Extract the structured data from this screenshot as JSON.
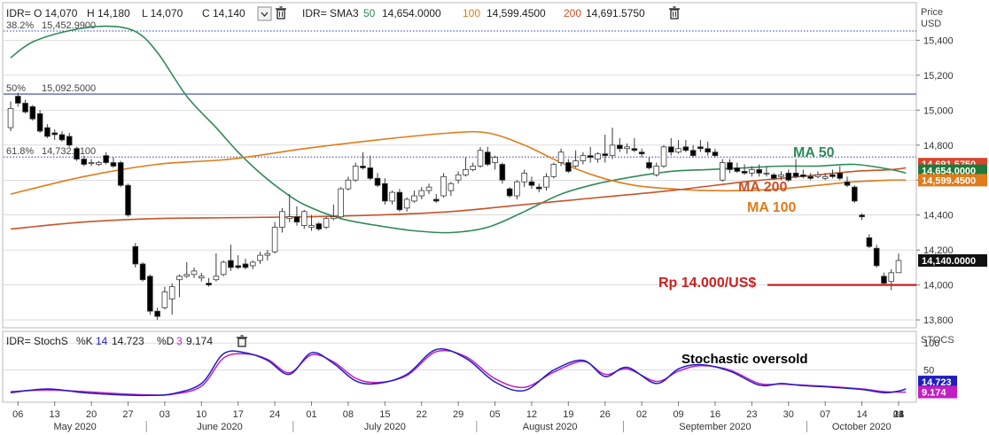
{
  "colors": {
    "up": "#ffffff",
    "down": "#000000",
    "candle_edge": "#3a3a3a",
    "ma50": "#2e8b57",
    "ma100": "#e07b1a",
    "ma200": "#c8532a",
    "support_line": "#cc1f1f",
    "fib_dotted": "#2b3fa8",
    "fib_solid": "#4b56b5",
    "stoch_k": "#1f1fbf",
    "stoch_d": "#c21ec2",
    "grid": "#c8c8c8",
    "box_green": "#1e7a3a",
    "box_orange": "#e07b1a",
    "box_red": "#d8452b",
    "box_blue": "#1f1fbf",
    "box_magenta": "#c21ec2",
    "box_black": "#111111"
  },
  "header": {
    "ohlc": [
      "IDR= O 14,070",
      "H 14,180",
      "L 14,070",
      "C 14,140"
    ],
    "sma_prefix": "IDR= SMA3",
    "sma": [
      {
        "len": "50",
        "value": "14,654.0000"
      },
      {
        "len": "100",
        "value": "14,599.4500"
      },
      {
        "len": "200",
        "value": "14,691.5750"
      }
    ],
    "icons": [
      "chevron-down-icon",
      "trash-icon"
    ]
  },
  "axis": {
    "price_title": "Price",
    "currency": "USD",
    "price_ticks": [
      13800,
      14000,
      14200,
      14400,
      14600,
      14800,
      15000,
      15200,
      15400
    ],
    "price_tick_labels": [
      "13,800",
      "14,000",
      "14,200",
      "14,400",
      "14,600",
      "14,800",
      "15,000",
      "15,200",
      "15,400"
    ],
    "stoch_title": "STOCS",
    "stoch_ticks": [
      100,
      50
    ],
    "stoch_tick_labels": [
      "100",
      "50"
    ],
    "date_ticks": [
      "06",
      "13",
      "20",
      "27",
      "03",
      "10",
      "17",
      "24",
      "01",
      "08",
      "15",
      "22",
      "29",
      "05",
      "12",
      "19",
      "26",
      "02",
      "09",
      "16",
      "23",
      "30",
      "07",
      "14",
      "21",
      "28",
      "04",
      "11"
    ],
    "months": [
      "May 2020",
      "June 2020",
      "July 2020",
      "August 2020",
      "September 2020",
      "October 2020"
    ]
  },
  "fibs": [
    {
      "label": "38.2%",
      "value_label": "15,452.9900",
      "value": 15452.99,
      "style": "dotted"
    },
    {
      "label": "50%",
      "value_label": "15,092.5000",
      "value": 15092.5,
      "style": "solid"
    },
    {
      "label": "61.8%",
      "value_label": "14,732.0100",
      "value": 14732.01,
      "style": "dotted"
    }
  ],
  "price_boxes": [
    {
      "text": "14,691.5750",
      "value": 14691.575,
      "color_key": "box_red"
    },
    {
      "text": "14,654.0000",
      "value": 14654,
      "color_key": "box_green"
    },
    {
      "text": "14,599.4500",
      "value": 14599.45,
      "color_key": "box_orange"
    },
    {
      "text": "14,140.0000",
      "value": 14140,
      "color_key": "box_black"
    }
  ],
  "stoch_boxes": [
    {
      "text": "14.723",
      "value": 14.723,
      "color_key": "box_blue"
    },
    {
      "text": "9.174",
      "value": 9.174,
      "color_key": "box_magenta"
    }
  ],
  "annotations": {
    "ma50": "MA 50",
    "ma200": "MA 200",
    "ma100": "MA 100",
    "support": "Rp 14.000/US$",
    "support_value": 14000,
    "stoch_note": "Stochastic oversold"
  },
  "stoch_legend": {
    "prefix": "IDR= StochS",
    "k_label": "%K",
    "k_len": "14",
    "k_value": "14.723",
    "d_label": "%D",
    "d_len": "3",
    "d_value": "9.174"
  },
  "chart_data": {
    "type": "candlestick",
    "title": "",
    "ylabel": "Price USD",
    "ylim": [
      13760,
      15610
    ],
    "candles_ohlc": [
      [
        14900,
        15050,
        14880,
        15010
      ],
      [
        15080,
        15100,
        15020,
        15040
      ],
      [
        15040,
        15060,
        14980,
        14990
      ],
      [
        15020,
        15030,
        14940,
        14950
      ],
      [
        14980,
        15000,
        14870,
        14880
      ],
      [
        14900,
        14920,
        14840,
        14850
      ],
      [
        14870,
        14890,
        14830,
        14860
      ],
      [
        14860,
        14880,
        14820,
        14830
      ],
      [
        14850,
        14870,
        14790,
        14800
      ],
      [
        14780,
        14790,
        14710,
        14720
      ],
      [
        14720,
        14740,
        14680,
        14690
      ],
      [
        14700,
        14720,
        14680,
        14700
      ],
      [
        14690,
        14710,
        14680,
        14700
      ],
      [
        14740,
        14760,
        14690,
        14700
      ],
      [
        14700,
        14730,
        14670,
        14680
      ],
      [
        14700,
        14710,
        14560,
        14570
      ],
      [
        14570,
        14580,
        14390,
        14400
      ],
      [
        14220,
        14240,
        14100,
        14120
      ],
      [
        14120,
        14130,
        14020,
        14030
      ],
      [
        14050,
        14060,
        13830,
        13850
      ],
      [
        13850,
        13870,
        13800,
        13820
      ],
      [
        13870,
        13990,
        13860,
        13960
      ],
      [
        13920,
        14010,
        13830,
        13990
      ],
      [
        14030,
        14060,
        13930,
        14050
      ],
      [
        14050,
        14130,
        14040,
        14060
      ],
      [
        14060,
        14100,
        14040,
        14080
      ],
      [
        14040,
        14070,
        14020,
        14050
      ],
      [
        14010,
        14040,
        13990,
        14000
      ],
      [
        14030,
        14180,
        14020,
        14050
      ],
      [
        14060,
        14140,
        14050,
        14130
      ],
      [
        14140,
        14230,
        14080,
        14100
      ],
      [
        14110,
        14170,
        14090,
        14100
      ],
      [
        14120,
        14150,
        14090,
        14100
      ],
      [
        14110,
        14140,
        14090,
        14130
      ],
      [
        14140,
        14190,
        14120,
        14170
      ],
      [
        14170,
        14200,
        14140,
        14180
      ],
      [
        14190,
        14360,
        14180,
        14330
      ],
      [
        14330,
        14440,
        14300,
        14420
      ],
      [
        14380,
        14520,
        14360,
        14390
      ],
      [
        14390,
        14450,
        14340,
        14360
      ],
      [
        14340,
        14430,
        14320,
        14420
      ],
      [
        14330,
        14400,
        14310,
        14340
      ],
      [
        14350,
        14360,
        14310,
        14320
      ],
      [
        14330,
        14390,
        14320,
        14380
      ],
      [
        14380,
        14460,
        14370,
        14390
      ],
      [
        14390,
        14560,
        14380,
        14550
      ],
      [
        14550,
        14620,
        14540,
        14600
      ],
      [
        14600,
        14700,
        14590,
        14680
      ],
      [
        14680,
        14760,
        14660,
        14670
      ],
      [
        14670,
        14740,
        14600,
        14610
      ],
      [
        14610,
        14640,
        14560,
        14570
      ],
      [
        14580,
        14610,
        14460,
        14480
      ],
      [
        14480,
        14540,
        14460,
        14530
      ],
      [
        14530,
        14550,
        14420,
        14430
      ],
      [
        14440,
        14500,
        14420,
        14490
      ],
      [
        14480,
        14540,
        14470,
        14510
      ],
      [
        14510,
        14560,
        14490,
        14540
      ],
      [
        14540,
        14580,
        14520,
        14560
      ],
      [
        14490,
        14520,
        14470,
        14480
      ],
      [
        14510,
        14640,
        14500,
        14620
      ],
      [
        14540,
        14590,
        14510,
        14580
      ],
      [
        14600,
        14650,
        14580,
        14630
      ],
      [
        14630,
        14730,
        14620,
        14660
      ],
      [
        14660,
        14700,
        14650,
        14680
      ],
      [
        14680,
        14790,
        14670,
        14770
      ],
      [
        14760,
        14790,
        14680,
        14690
      ],
      [
        14700,
        14740,
        14660,
        14730
      ],
      [
        14690,
        14700,
        14580,
        14600
      ],
      [
        14550,
        14560,
        14500,
        14510
      ],
      [
        14510,
        14600,
        14490,
        14590
      ],
      [
        14590,
        14660,
        14560,
        14640
      ],
      [
        14590,
        14620,
        14550,
        14570
      ],
      [
        14560,
        14580,
        14530,
        14550
      ],
      [
        14560,
        14640,
        14540,
        14620
      ],
      [
        14620,
        14700,
        14610,
        14690
      ],
      [
        14700,
        14780,
        14680,
        14760
      ],
      [
        14700,
        14720,
        14640,
        14650
      ],
      [
        14680,
        14770,
        14670,
        14710
      ],
      [
        14710,
        14760,
        14690,
        14740
      ],
      [
        14740,
        14790,
        14700,
        14730
      ],
      [
        14720,
        14760,
        14700,
        14750
      ],
      [
        14750,
        14860,
        14700,
        14740
      ],
      [
        14740,
        14900,
        14720,
        14800
      ],
      [
        14800,
        14840,
        14760,
        14780
      ],
      [
        14780,
        14810,
        14750,
        14790
      ],
      [
        14780,
        14840,
        14760,
        14770
      ],
      [
        14760,
        14780,
        14730,
        14750
      ],
      [
        14700,
        14730,
        14660,
        14670
      ],
      [
        14630,
        14700,
        14620,
        14680
      ],
      [
        14680,
        14800,
        14670,
        14790
      ],
      [
        14790,
        14840,
        14740,
        14760
      ],
      [
        14760,
        14830,
        14750,
        14780
      ],
      [
        14790,
        14830,
        14760,
        14770
      ],
      [
        14770,
        14800,
        14730,
        14740
      ],
      [
        14790,
        14830,
        14760,
        14780
      ],
      [
        14780,
        14820,
        14740,
        14760
      ],
      [
        14760,
        14780,
        14730,
        14740
      ],
      [
        14600,
        14720,
        14590,
        14700
      ],
      [
        14700,
        14720,
        14640,
        14660
      ],
      [
        14670,
        14700,
        14640,
        14650
      ],
      [
        14650,
        14690,
        14630,
        14640
      ],
      [
        14640,
        14680,
        14620,
        14660
      ],
      [
        14660,
        14690,
        14620,
        14640
      ],
      [
        14640,
        14680,
        14620,
        14640
      ],
      [
        14630,
        14640,
        14600,
        14610
      ],
      [
        14620,
        14650,
        14600,
        14630
      ],
      [
        14640,
        14660,
        14590,
        14600
      ],
      [
        14640,
        14720,
        14610,
        14620
      ],
      [
        14630,
        14660,
        14610,
        14620
      ],
      [
        14620,
        14640,
        14600,
        14610
      ],
      [
        14620,
        14650,
        14610,
        14630
      ],
      [
        14610,
        14640,
        14600,
        14620
      ],
      [
        14630,
        14660,
        14610,
        14620
      ],
      [
        14640,
        14680,
        14600,
        14610
      ],
      [
        14590,
        14620,
        14560,
        14570
      ],
      [
        14560,
        14570,
        14470,
        14480
      ],
      [
        14400,
        14410,
        14370,
        14390
      ],
      [
        14270,
        14290,
        14210,
        14220
      ],
      [
        14210,
        14230,
        14100,
        14110
      ],
      [
        14050,
        14070,
        14000,
        14010
      ],
      [
        14020,
        14090,
        13970,
        14070
      ],
      [
        14070,
        14180,
        14070,
        14140
      ]
    ],
    "series": [
      {
        "name": "MA 50",
        "color_key": "ma50",
        "width": 1.6,
        "x": [
          0,
          3,
          8,
          13,
          17,
          20,
          24,
          28,
          31,
          34,
          37,
          40,
          45,
          50,
          55,
          60,
          65,
          70,
          75,
          80,
          85,
          90,
          95,
          100,
          105,
          110,
          115,
          120,
          122
        ],
        "y": [
          15300,
          15390,
          15455,
          15480,
          15450,
          15330,
          15080,
          14900,
          14760,
          14640,
          14540,
          14460,
          14380,
          14340,
          14310,
          14300,
          14330,
          14420,
          14520,
          14580,
          14620,
          14650,
          14660,
          14670,
          14680,
          14680,
          14690,
          14660,
          14640
        ]
      },
      {
        "name": "MA 100",
        "color_key": "ma100",
        "width": 1.6,
        "x": [
          0,
          10,
          20,
          30,
          40,
          50,
          60,
          65,
          70,
          75,
          80,
          85,
          90,
          95,
          100,
          105,
          110,
          115,
          120,
          122
        ],
        "y": [
          14520,
          14620,
          14690,
          14720,
          14780,
          14830,
          14870,
          14870,
          14800,
          14700,
          14620,
          14570,
          14550,
          14540,
          14540,
          14550,
          14570,
          14590,
          14600,
          14600
        ]
      },
      {
        "name": "MA 200",
        "color_key": "ma200",
        "width": 1.6,
        "x": [
          0,
          10,
          20,
          30,
          40,
          50,
          60,
          70,
          80,
          90,
          100,
          105,
          110,
          115,
          120,
          122
        ],
        "y": [
          14320,
          14360,
          14380,
          14385,
          14390,
          14400,
          14420,
          14460,
          14500,
          14540,
          14590,
          14610,
          14630,
          14650,
          14660,
          14670
        ]
      }
    ],
    "stochastic": {
      "ylim": [
        -8,
        120
      ],
      "k": {
        "name": "%K",
        "color_key": "stoch_k",
        "x": [
          0,
          5,
          10,
          15,
          19,
          22,
          26,
          29,
          32,
          35,
          38,
          41,
          44,
          47,
          50,
          54,
          58,
          62,
          66,
          70,
          74,
          78,
          81,
          84,
          88,
          91,
          94,
          98,
          102,
          105,
          108,
          112,
          116,
          119,
          121,
          122
        ],
        "y": [
          8,
          15,
          8,
          4,
          3,
          6,
          25,
          80,
          82,
          68,
          42,
          82,
          62,
          30,
          25,
          42,
          88,
          72,
          28,
          12,
          50,
          68,
          38,
          55,
          25,
          52,
          60,
          48,
          22,
          25,
          21,
          18,
          14,
          8,
          11,
          15
        ]
      },
      "d": {
        "name": "%D",
        "color_key": "stoch_d",
        "x": [
          0,
          5,
          10,
          15,
          19,
          22,
          26,
          29,
          32,
          35,
          38,
          41,
          44,
          47,
          50,
          54,
          58,
          62,
          66,
          70,
          74,
          78,
          81,
          84,
          88,
          91,
          94,
          98,
          102,
          105,
          108,
          112,
          116,
          119,
          121,
          122
        ],
        "y": [
          10,
          13,
          10,
          6,
          4,
          5,
          20,
          72,
          80,
          70,
          45,
          78,
          65,
          35,
          27,
          40,
          84,
          75,
          34,
          18,
          46,
          66,
          42,
          52,
          29,
          48,
          58,
          50,
          25,
          24,
          22,
          19,
          15,
          10,
          9,
          9
        ]
      },
      "ticks": [
        100,
        50
      ]
    }
  }
}
